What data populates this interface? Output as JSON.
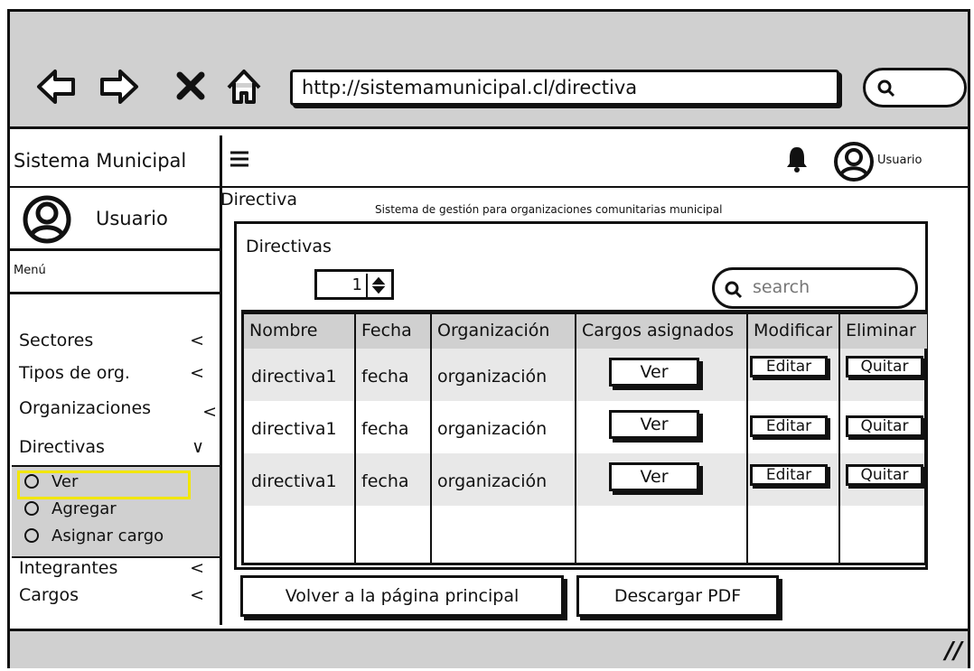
{
  "browser": {
    "url": "http://sistemamunicipal.cl/directiva",
    "icons": [
      "back-arrow-icon",
      "forward-arrow-icon",
      "close-x-icon",
      "home-icon",
      "search-icon"
    ]
  },
  "app": {
    "brand": "Sistema Municipal",
    "top_user_label": "Usuario"
  },
  "sidebar": {
    "user_name": "Usuario",
    "menu_header": "Menú",
    "items": [
      {
        "label": "Sectores",
        "chevron": "<"
      },
      {
        "label": "Tipos de org.",
        "chevron": "<"
      },
      {
        "label": "Organizaciones",
        "chevron": "<"
      },
      {
        "label": "Directivas",
        "chevron": "∨"
      }
    ],
    "subitems": [
      {
        "label": "Ver"
      },
      {
        "label": "Agregar"
      },
      {
        "label": "Asignar cargo"
      }
    ],
    "items_after": [
      {
        "label": "Integrantes",
        "chevron": "<"
      },
      {
        "label": "Cargos",
        "chevron": "<"
      }
    ],
    "highlight_color": "#f2e600"
  },
  "main": {
    "title": "Directiva",
    "subtitle": "Sistema de gestión para organizaciones comunitarias municipal",
    "panel_title": "Directivas",
    "page_number": "1",
    "search_placeholder": "search",
    "table": {
      "headers": [
        "Nombre",
        "Fecha",
        "Organización",
        "Cargos asignados",
        "Modificar",
        "Eliminar"
      ],
      "rows": [
        {
          "nombre": "directiva1",
          "fecha": "fecha",
          "organizacion": "organización",
          "cargos": "Ver",
          "modificar": "Editar",
          "eliminar": "Quitar"
        },
        {
          "nombre": "directiva1",
          "fecha": "fecha",
          "organizacion": "organización",
          "cargos": "Ver",
          "modificar": "Editar",
          "eliminar": "Quitar"
        },
        {
          "nombre": "directiva1",
          "fecha": "fecha",
          "organizacion": "organización",
          "cargos": "Ver",
          "modificar": "Editar",
          "eliminar": "Quitar"
        }
      ]
    },
    "back_button": "Volver a la página principal",
    "pdf_button": "Descargar PDF"
  }
}
